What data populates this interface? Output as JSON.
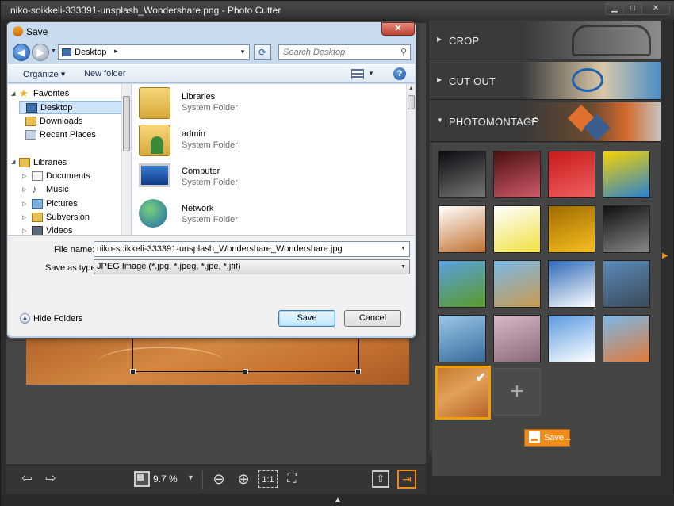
{
  "app": {
    "title": "niko-soikkeli-333391-unsplash_Wondershare.png - Photo Cutter",
    "window_buttons": {
      "minimize": "▁",
      "maximize": "□",
      "close": "✕"
    },
    "colors": {
      "accent": "#f08c1a",
      "background": "#2e2e2e"
    }
  },
  "right_panel": {
    "sections": [
      {
        "label": "CROP"
      },
      {
        "label": "CUT-OUT"
      },
      {
        "label": "PHOTOMONTAGE"
      }
    ],
    "undo_icon": "↶",
    "gallery": {
      "thumbnails": [
        {
          "name": "planet-surface",
          "colors": [
            "#0b0b10",
            "#777"
          ]
        },
        {
          "name": "heart-tree",
          "colors": [
            "#4a1010",
            "#d05a6a"
          ]
        },
        {
          "name": "red-heart",
          "colors": [
            "#c81a1a",
            "#f06060"
          ]
        },
        {
          "name": "comic",
          "colors": [
            "#f5d400",
            "#2a80d0"
          ]
        },
        {
          "name": "dogs",
          "colors": [
            "#ffffff",
            "#c07030"
          ]
        },
        {
          "name": "cartoon-monster",
          "colors": [
            "#ffffff",
            "#f0e040"
          ]
        },
        {
          "name": "golden-bokeh",
          "colors": [
            "#a06a00",
            "#f8c020"
          ]
        },
        {
          "name": "sparkles",
          "colors": [
            "#101010",
            "#888"
          ]
        },
        {
          "name": "cow",
          "colors": [
            "#5aa0e0",
            "#5a9a2a"
          ]
        },
        {
          "name": "eiffel-tower",
          "colors": [
            "#7ab8e8",
            "#c89a50"
          ]
        },
        {
          "name": "snowman",
          "colors": [
            "#2e6ab8",
            "#ffffff"
          ]
        },
        {
          "name": "city-skyline",
          "colors": [
            "#5a8ab8",
            "#3a4a5a"
          ]
        },
        {
          "name": "venice",
          "colors": [
            "#9ac8e8",
            "#3a6a9a"
          ]
        },
        {
          "name": "blossom-path",
          "colors": [
            "#d8b8c8",
            "#8a6a7a"
          ]
        },
        {
          "name": "snowy-sun",
          "colors": [
            "#5a9ae0",
            "#ffffff"
          ]
        },
        {
          "name": "desert-tree",
          "colors": [
            "#7ab8e8",
            "#e07a3a"
          ]
        }
      ],
      "selected_check": "✔",
      "add_icon": "+",
      "save_label": "Save..."
    }
  },
  "bottom_toolbar": {
    "prev_icon": "⇦",
    "next_icon": "⇨",
    "zoom": "9.7 %",
    "zoom_dropdown": "▼",
    "zoom_out_icon": "⊖",
    "zoom_in_icon": "⊕",
    "actual_size_icon": "1:1",
    "fit_icon": "⛶",
    "import_icon": "⇧",
    "export_icon": "⇥",
    "collapse_icon": "▲"
  },
  "dialog": {
    "title": "Save",
    "close_label": "✕",
    "back_icon": "◀",
    "forward_icon": "▶",
    "address": "Desktop",
    "address_separator": "▸",
    "refresh_icon": "⟳",
    "search_placeholder": "Search Desktop",
    "search_icon": "⚲",
    "toolbar": {
      "organize": "Organize ▾",
      "new_folder": "New folder",
      "help": "?"
    },
    "nav": {
      "favorites": "Favorites",
      "desktop": "Desktop",
      "downloads": "Downloads",
      "recent": "Recent Places",
      "libraries": "Libraries",
      "documents": "Documents",
      "music": "Music",
      "pictures": "Pictures",
      "subversion": "Subversion",
      "videos": "Videos"
    },
    "files": [
      {
        "name": "Libraries",
        "type": "System Folder"
      },
      {
        "name": "admin",
        "type": "System Folder"
      },
      {
        "name": "Computer",
        "type": "System Folder"
      },
      {
        "name": "Network",
        "type": "System Folder"
      }
    ],
    "file_name_label": "File name:",
    "file_name_value": "niko-soikkeli-333391-unsplash_Wondershare_Wondershare.jpg",
    "save_type_label": "Save as type:",
    "save_type_value": "JPEG Image (*.jpg, *.jpeg, *.jpe, *.jfif)",
    "hide_folders": "Hide Folders",
    "save_button": "Save",
    "cancel_button": "Cancel"
  }
}
